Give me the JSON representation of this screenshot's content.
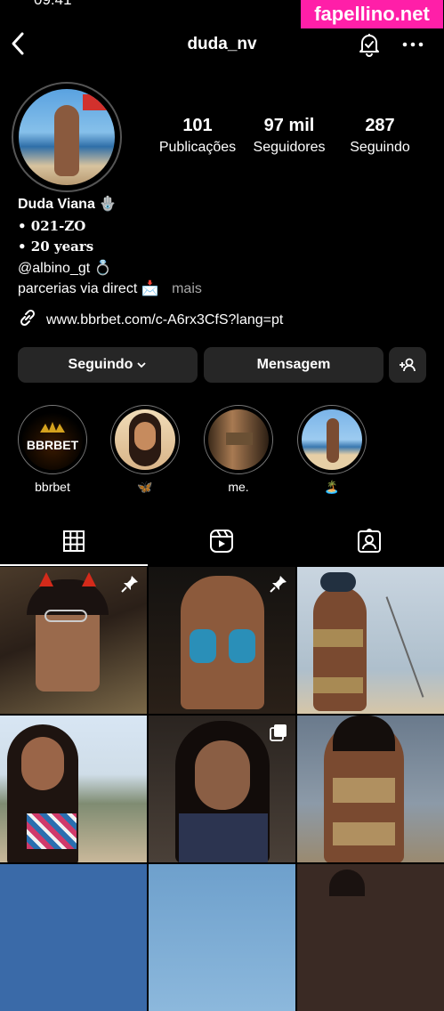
{
  "status_bar": {
    "time": "09:41"
  },
  "watermark": "fapellino.net",
  "nav": {
    "username": "duda_nv"
  },
  "stats": [
    {
      "value": "101",
      "label": "Publicações"
    },
    {
      "value": "97 mil",
      "label": "Seguidores"
    },
    {
      "value": "287",
      "label": "Seguindo"
    }
  ],
  "bio": {
    "name": "Duda Viana 🪬",
    "line1": "• 𝟎𝟐𝟏-𝐙𝐎",
    "line2": "• 20 𝐲𝐞𝐚𝐫𝐬",
    "mention": "@albino_gt 💍",
    "partnerships": "parcerias via direct 📩",
    "more": "mais"
  },
  "link": "www.bbrbet.com/c-A6rx3CfS?lang=pt",
  "buttons": {
    "following": "Seguindo",
    "message": "Mensagem"
  },
  "highlights": [
    {
      "label": "bbrbet",
      "logo_text": "BBRBET"
    },
    {
      "label": "🦋"
    },
    {
      "label": "me."
    },
    {
      "label": "🏝️"
    }
  ],
  "icons": {
    "back": "chevron-left-icon",
    "bell": "notification-bell-icon",
    "more": "more-horizontal-icon",
    "link": "link-icon",
    "add_person": "add-person-icon",
    "grid": "grid-icon",
    "reels": "reels-icon",
    "tagged": "tagged-icon",
    "pin": "pin-icon",
    "carousel": "carousel-icon"
  },
  "colors": {
    "background": "#000000",
    "button": "#262626",
    "secondary_text": "#a8a8a8",
    "watermark": "#ff1fa8"
  }
}
